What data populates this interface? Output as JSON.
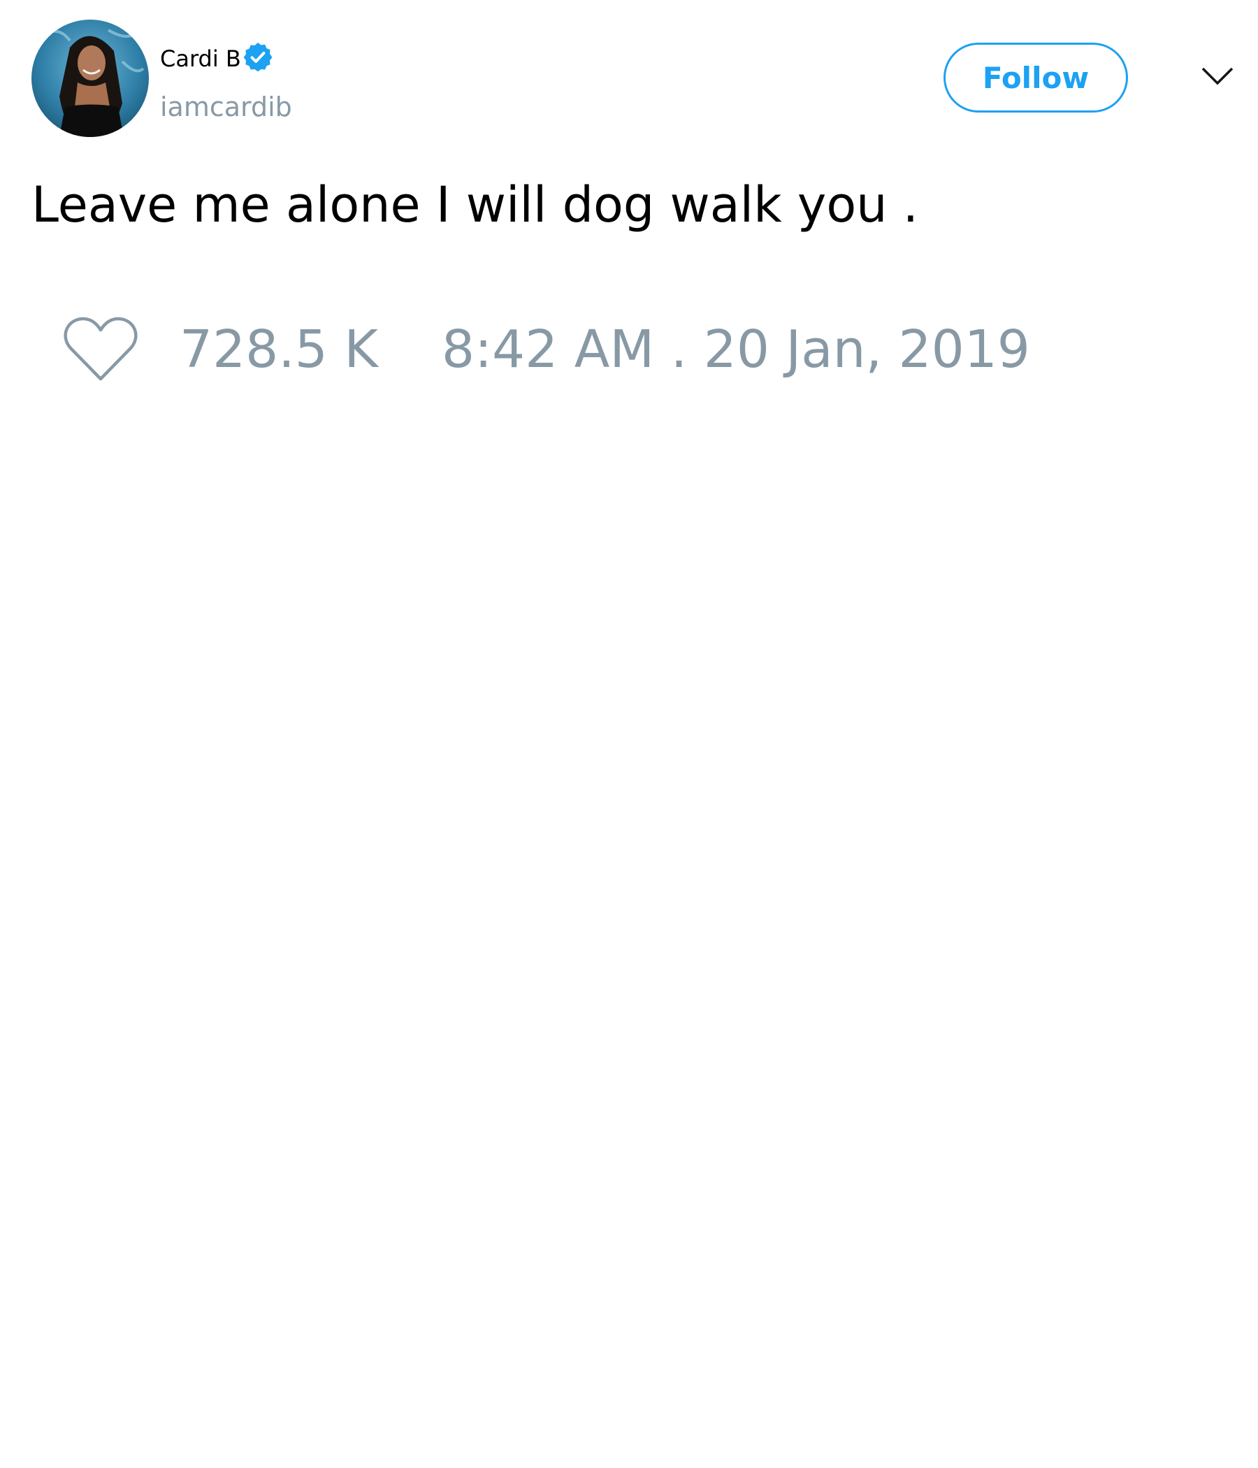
{
  "user": {
    "display_name": "Cardi B",
    "handle": "iamcardib",
    "verified": true,
    "avatar_icon": "profile-photo"
  },
  "actions": {
    "follow_label": "Follow",
    "menu_icon": "chevron-down-icon"
  },
  "tweet": {
    "text": "Leave me alone I will dog walk you ."
  },
  "meta": {
    "like_icon": "heart-icon",
    "likes": "728.5 K",
    "timestamp": "8:42 AM . 20 Jan, 2019"
  },
  "colors": {
    "accent": "#1da1f2",
    "secondary_text": "#8899a6",
    "primary_text": "#000000",
    "background": "#ffffff"
  }
}
